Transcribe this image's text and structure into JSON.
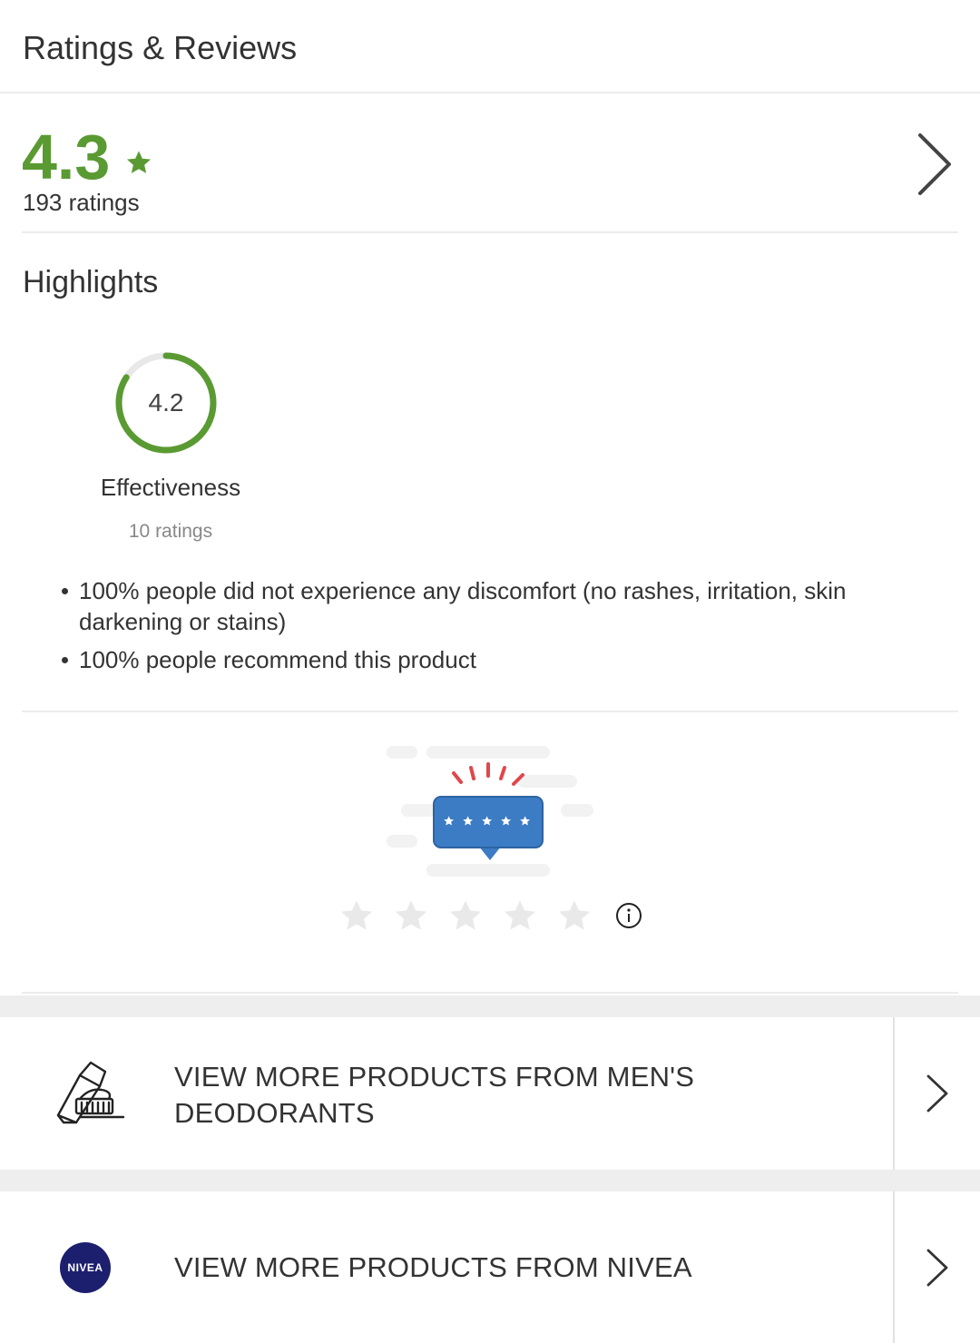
{
  "header": {
    "title": "Ratings & Reviews"
  },
  "summary": {
    "score": "4.3",
    "ratings_count": "193 ratings"
  },
  "highlights": {
    "title": "Highlights",
    "metric": {
      "value": "4.2",
      "max": 5,
      "label": "Effectiveness",
      "count": "10 ratings"
    },
    "bullets": [
      "100% people did not experience any discomfort (no rashes, irritation, skin darkening or stains)",
      "100% people recommend this product"
    ]
  },
  "rate_stars": 5,
  "links": [
    {
      "text": "VIEW MORE PRODUCTS FROM MEN'S DEODORANTS",
      "icon": "toothbrush-toothpaste-icon"
    },
    {
      "text": "VIEW MORE PRODUCTS FROM NIVEA",
      "icon": "nivea-logo",
      "logo_text": "NIVEA"
    }
  ],
  "colors": {
    "accent_green": "#5a9a33",
    "ring_track": "#e8e8e8",
    "illustration_blue": "#3c7cc4",
    "illustration_red": "#e0474c",
    "nivea_blue": "#1c1f6e"
  }
}
